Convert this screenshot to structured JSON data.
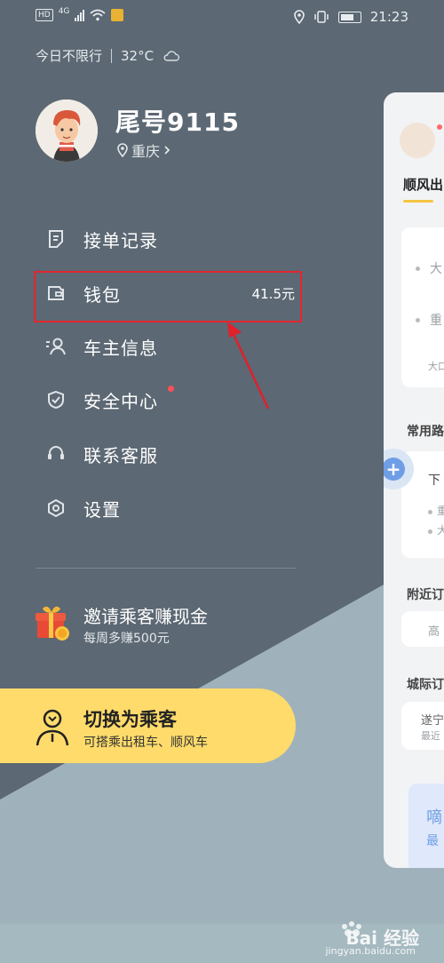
{
  "status_bar": {
    "network_label": "HD",
    "network_gen": "4G",
    "time": "21:23"
  },
  "weather": {
    "restriction": "今日不限行",
    "temperature": "32°C"
  },
  "profile": {
    "name": "尾号9115",
    "city": "重庆"
  },
  "menu": {
    "items": [
      {
        "label": "接单记录",
        "icon": "order-record-icon"
      },
      {
        "label": "钱包",
        "icon": "wallet-icon",
        "value": "41.5元"
      },
      {
        "label": "车主信息",
        "icon": "driver-info-icon"
      },
      {
        "label": "安全中心",
        "icon": "shield-icon",
        "badge_color": "#ff4e5a"
      },
      {
        "label": "联系客服",
        "icon": "headset-icon"
      },
      {
        "label": "设置",
        "icon": "settings-icon"
      }
    ]
  },
  "invite": {
    "title": "邀请乘客赚现金",
    "subtitle": "每周多赚500元"
  },
  "switch_mode": {
    "title": "切换为乘客",
    "subtitle": "可搭乘出租车、顺风车"
  },
  "background_card": {
    "tab": "顺风出",
    "section_common": "常用路",
    "route_next": "下",
    "route_a": "重",
    "route_b": "大",
    "section_nearby": "附近订",
    "nearby_item": "高",
    "section_intercity": "城际订",
    "intercity_item": "遂宁",
    "intercity_sub": "最近",
    "promo_title": "嘀",
    "promo_sub": "最",
    "top_a": "大",
    "top_b": "重",
    "top_c": "大口"
  },
  "watermark": {
    "brand": "Bai 经验",
    "url": "jingyan.baidu.com"
  },
  "colors": {
    "drawer_bg": "#5c6873",
    "accent_yellow": "#fedb6b",
    "highlight_red": "#e3262f"
  }
}
